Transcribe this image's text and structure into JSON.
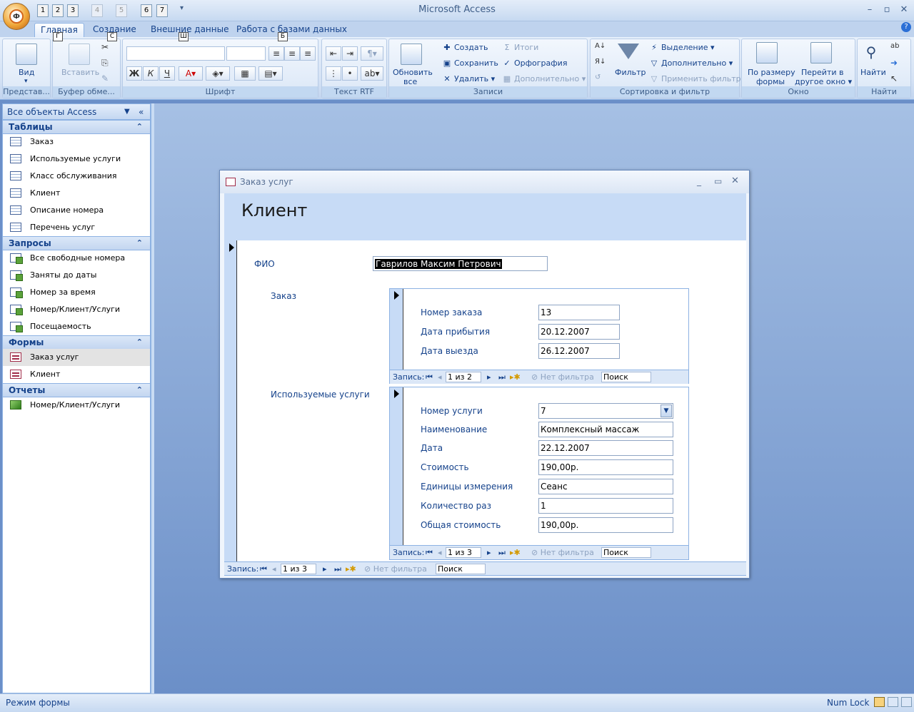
{
  "app_title": "Microsoft Access",
  "office_button_letter": "Ф",
  "qat_keytips": [
    "1",
    "2",
    "3",
    "4",
    "5",
    "6",
    "7"
  ],
  "tabs": [
    {
      "label": "Главная",
      "keytip": "Г"
    },
    {
      "label": "Создание",
      "keytip": "С"
    },
    {
      "label": "Внешние данные",
      "keytip": "Ш"
    },
    {
      "label": "Работа с базами данных",
      "keytip": "Б"
    }
  ],
  "ribbon": {
    "views": {
      "button": "Вид",
      "group": "Представ..."
    },
    "clipboard": {
      "button": "Вставить",
      "group": "Буфер обме..."
    },
    "font": {
      "group": "Шрифт",
      "bold": "Ж",
      "italic": "К",
      "underline": "Ч"
    },
    "rtf": {
      "group": "Текст RTF"
    },
    "records": {
      "group": "Записи",
      "refresh": "Обновить",
      "refresh2": "все",
      "new": "Создать",
      "save": "Сохранить",
      "delete": "Удалить",
      "totals": "Итоги",
      "spelling": "Орфография",
      "more": "Дополнительно"
    },
    "sort": {
      "group": "Сортировка и фильтр",
      "filter": "Фильтр",
      "selection": "Выделение",
      "advanced": "Дополнительно",
      "apply": "Применить фильтр"
    },
    "window": {
      "group": "Окно",
      "fit1": "По размеру",
      "fit2": "формы",
      "switch1": "Перейти в",
      "switch2": "другое окно"
    },
    "find": {
      "group": "Найти",
      "find": "Найти"
    }
  },
  "nav": {
    "header": "Все объекты Access",
    "sections": [
      {
        "title": "Таблицы",
        "items": [
          "Заказ",
          "Используемые услуги",
          "Класс обслуживания",
          "Клиент",
          "Описание номера",
          "Перечень услуг"
        ]
      },
      {
        "title": "Запросы",
        "items": [
          "Все свободные номера",
          "Заняты до даты",
          "Номер за время",
          "Номер/Клиент/Услуги",
          "Посещаемость"
        ]
      },
      {
        "title": "Формы",
        "items": [
          "Заказ услуг",
          "Клиент"
        ]
      },
      {
        "title": "Отчеты",
        "items": [
          "Номер/Клиент/Услуги"
        ]
      }
    ]
  },
  "form": {
    "window_title": "Заказ услуг",
    "header": "Клиент",
    "fio_label": "ФИО",
    "fio_value": "Гаврилов Максим Петрович",
    "order_label": "Заказ",
    "order": {
      "fields": [
        {
          "label": "Номер заказа",
          "value": "13"
        },
        {
          "label": "Дата прибытия",
          "value": "20.12.2007"
        },
        {
          "label": "Дата выезда",
          "value": "26.12.2007"
        }
      ],
      "nav": {
        "record_label": "Запись:",
        "position": "1 из 2",
        "no_filter": "Нет фильтра",
        "search": "Поиск"
      }
    },
    "services_label": "Используемые услуги",
    "services": {
      "fields": [
        {
          "label": "Номер услуги",
          "value": "7"
        },
        {
          "label": "Наименование",
          "value": "Комплексный массаж"
        },
        {
          "label": "Дата",
          "value": "22.12.2007"
        },
        {
          "label": "Стоимость",
          "value": "190,00р."
        },
        {
          "label": "Единицы измерения",
          "value": "Сеанс"
        },
        {
          "label": "Количество раз",
          "value": "1"
        },
        {
          "label": "Общая стоимость",
          "value": "190,00р."
        }
      ],
      "nav": {
        "record_label": "Запись:",
        "position": "1 из 3",
        "no_filter": "Нет фильтра",
        "search": "Поиск"
      }
    },
    "main_nav": {
      "record_label": "Запись:",
      "position": "1 из 3",
      "no_filter": "Нет фильтра",
      "search": "Поиск"
    }
  },
  "status": {
    "left": "Режим формы",
    "numlock": "Num Lock"
  }
}
